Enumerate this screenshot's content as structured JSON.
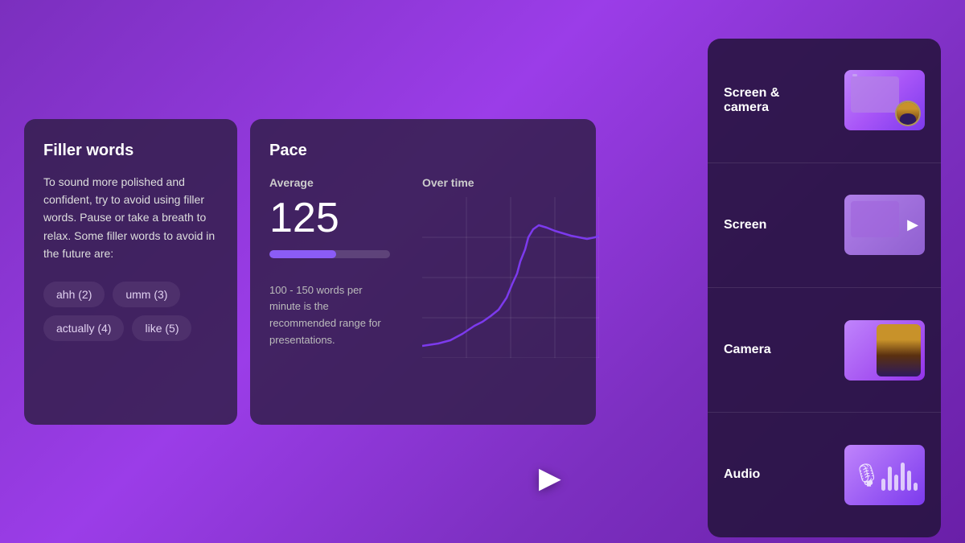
{
  "fillerWords": {
    "title": "Filler words",
    "description": "To sound more polished and confident, try to avoid using filler words. Pause or take a breath to relax. Some filler words to avoid in the future are:",
    "tags": [
      "ahh (2)",
      "umm (3)",
      "actually (4)",
      "like (5)"
    ]
  },
  "pace": {
    "title": "Pace",
    "averageLabel": "Average",
    "overTimeLabel": "Over time",
    "averageValue": "125",
    "note": "100 - 150 words per minute is the recommended range for presentations."
  },
  "rightPanel": {
    "items": [
      {
        "id": "screen-camera",
        "label": "Screen &\ncamera",
        "type": "screen-camera"
      },
      {
        "id": "screen",
        "label": "Screen",
        "type": "screen"
      },
      {
        "id": "camera",
        "label": "Camera",
        "type": "camera"
      },
      {
        "id": "audio",
        "label": "Audio",
        "type": "audio"
      }
    ]
  }
}
